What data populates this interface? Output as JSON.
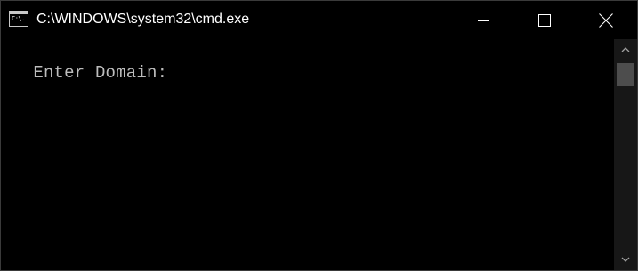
{
  "window": {
    "title": "C:\\WINDOWS\\system32\\cmd.exe",
    "app_icon_text": "C:\\."
  },
  "caption_buttons": {
    "minimize": "minimize-icon",
    "maximize": "maximize-icon",
    "close": "close-icon"
  },
  "console": {
    "lines": [
      "Enter Domain:"
    ]
  },
  "scrollbar": {
    "up": "chevron-up-icon",
    "down": "chevron-down-icon"
  },
  "colors": {
    "background": "#000000",
    "text": "#c0c0c0",
    "title_text": "#ffffff",
    "scroll_track": "#171717",
    "scroll_thumb": "#4d4d4d"
  }
}
